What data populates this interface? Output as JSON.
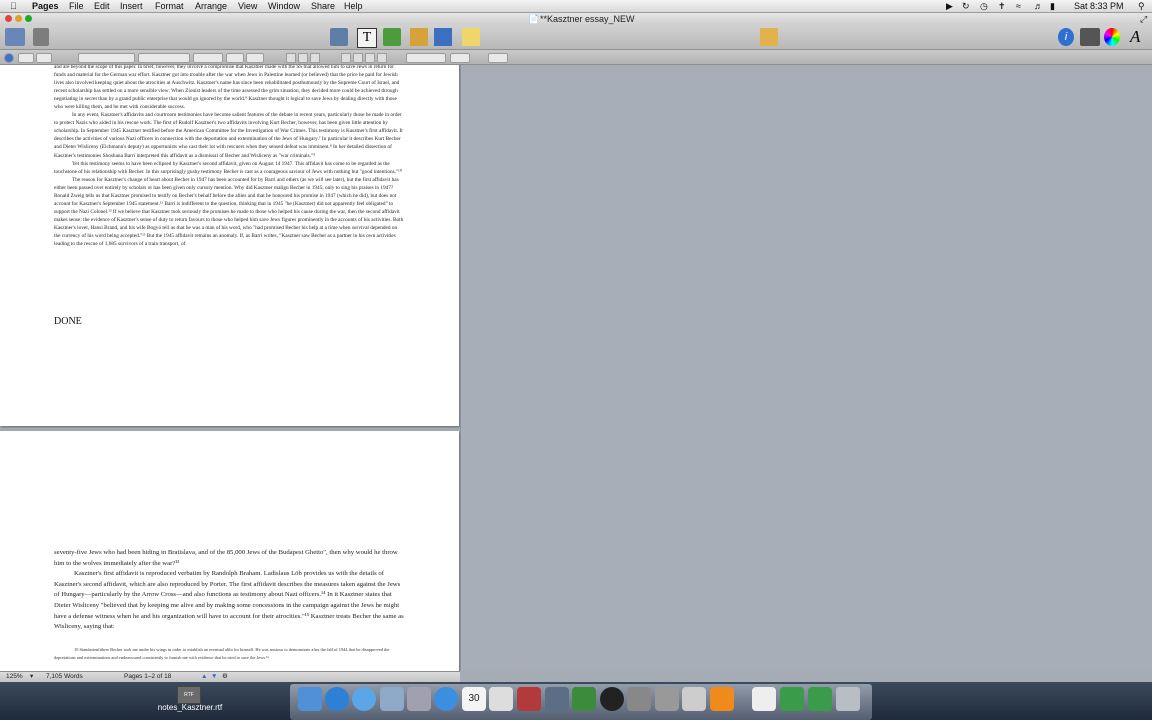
{
  "menubar": {
    "app": "Pages",
    "items": [
      "File",
      "Edit",
      "Insert",
      "Format",
      "Arrange",
      "View",
      "Window",
      "Share",
      "Help"
    ],
    "clock": "Sat 8:33 PM"
  },
  "window": {
    "title": "**Kasztner essay_NEW"
  },
  "document": {
    "page1_paragraphs": [
      {
        "indent": false,
        "text": "and are beyond the scope of this paper. In brief, however, they involve a compromise that Kasztner made with the SS that allowed him to save Jews in return for funds and material for the German war effort. Kasztner got into trouble after the war when Jews in Palestine learned (or believed) that the price he paid for Jewish lives also involved keeping quiet about the atrocities at Auschwitz. Kasztner's name has since been rehabilitated posthumously by the Supreme Court of Israel, and recent scholarship has settled on a more sensible view: When Zionist leaders of the time assessed the grim situation, they decided more could be achieved through negotiating in secret than by a grand public enterprise that would go ignored by the world.⁸ Kasztner thought it logical to save Jews by dealing directly with those who were killing them, and he met with considerable success."
      },
      {
        "indent": true,
        "text": "In any event, Kasztner's affidavits and courtroom testimonies have become salient features of the debate in recent years, particularly those he made in order to protect Nazis who aided in his rescue work. The first of Rudolf Kasztner's two affidavits involving Kurt Becher, however, has been given little attention by scholarship. In September 1945 Kasztner testified before the American Committee for the Investigation of War Crimes. This testimony is Kasztner's first affidavit. It describes the activities of various Nazi officers in connection with the deportation and extermination of the Jews of Hungary.⁷ In particular it describes Kurt Becher and Dieter Wisliceny (Eichmann's deputy) as opportunists who cast their lot with rescuers when they sensed defeat was imminent.⁸ In her detailed dissection of Kasztner's testimonies Shoshana Barri interpreted this affidavit as a dismissal of Becher and Wisliceny as \"war criminals.\"⁹"
      },
      {
        "indent": true,
        "text": "Yet this testimony seems to have been eclipsed by Kasztner's second affidavit, given on August 14 1947. This affidavit has come to be regarded as the touchstone of his relationship with Becher. In this surprisingly gushy testimony Becher is cast as a courageous saviour of Jews with nothing but \"good intentions.\"¹⁰"
      },
      {
        "indent": true,
        "text": "The reason for Kasztner's change of heart about Becher in 1947 has been accounted for by Barri and others (as we will see later), but the first affidavit has either been passed over entirely by scholars or has been given only cursory mention. Why did Kasztner malign Becher in 1945, only to sing his praises in 1947? Ronald Zweig tells us that Kasztner promised to testify on Becher's behalf before the allies and that he honoured his promise in 1947 (which he did), but does not account for Kasztner's September 1945 statement.¹¹ Barri is indifferent to the question, thinking that in 1945 \"he (Kasztner) did not apparently feel obligated\" to support the Nazi Colonel.¹² If we believe that Kasztner took seriously the promises he made to those who helped his cause during the war, then the second affidavit makes sense: the evidence of Kasztner's sense of duty to return favours to those who helped him save Jews figures prominently in the accounts of his activities. Both Kasztner's lover, Hansi Brand, and his wife Bogyó tell us that he was a man of his word, who \"had promised Becher his help at a time when survival depended on the currency of his word being accepted.\"¹³ But the 1945 affidavit remains an anomaly. If, as Barri writes, \"Kasztner saw Becher as a partner in his own activities leading to the rescue of 1,685 survivors of a train transport, of"
      }
    ],
    "done_label": "DONE",
    "page2_paragraphs": [
      {
        "indent": false,
        "text": "seventy-five Jews who had been hiding in Bratislava, and of the 85,000 Jews of the Budapest Ghetto\", then why would he throw him to the wolves immediately after the war?¹³"
      },
      {
        "indent": true,
        "text": "Kasztner's first affidavit is reproduced verbatim by Randolph Braham. Ladislaus Löb provides us with the details of Kasztner's second affidavit, which are also reproduced by Porter. The first affidavit describes the measures taken against the Jews of Hungary—particularly by the Arrow Cross—and also functions as testimony about Nazi officers.¹⁴ In it Kasztner states that Dieter Wisliceny \"believed that by keeping me alive and by making some concessions in the campaign against the Jews he might have a defense witness when he and his organization will have to account for their atrocities.\"¹⁵ Kasztner treats Becher the same as Wisliceny, saying that:"
      }
    ],
    "footnote": "10 Standartenführer Becher took me under his wings in order to establish an eventual alibi for himself. He was anxious to demonstrate after the fall of 1944 that he disapproved the deportations and exterminations and endeavoured consistently to furnish me with evidence that he tried to save the Jews.¹⁶"
  },
  "statusbar": {
    "zoom": "125%",
    "words": "7,105 Words",
    "pages": "Pages 1–2 of 18"
  },
  "desktop": {
    "file_icon_label": "RTF",
    "file_name": "notes_Kasztner.rtf"
  }
}
